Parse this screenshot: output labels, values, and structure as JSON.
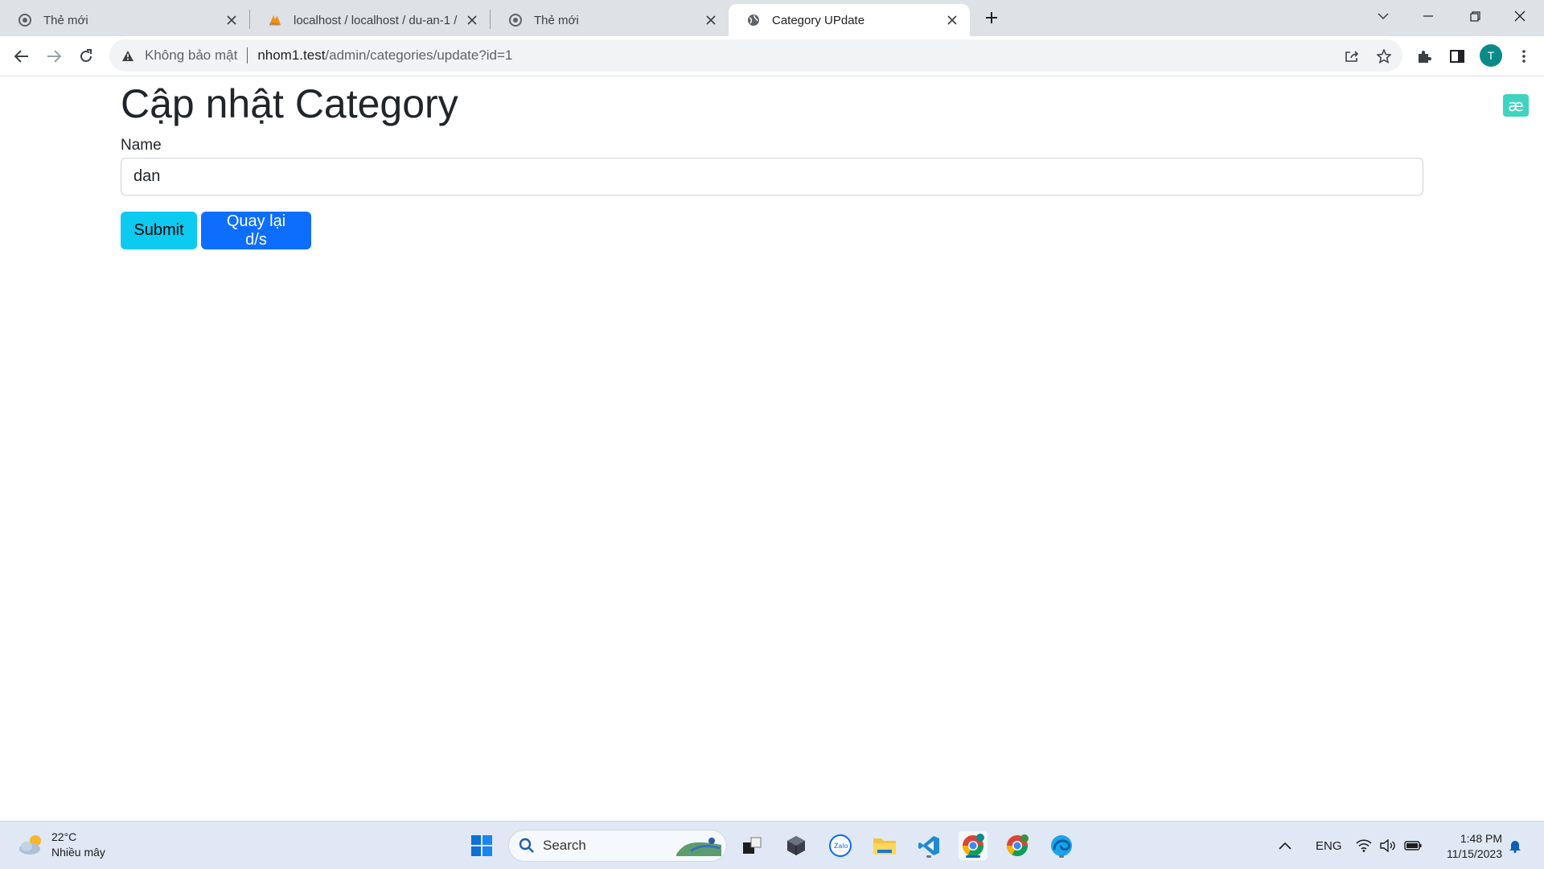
{
  "browser": {
    "tabs": [
      {
        "title": "Thẻ mới",
        "icon": "chrome-icon",
        "active": false
      },
      {
        "title": "localhost / localhost / du-an-1 / ",
        "icon": "phpmyadmin-icon",
        "active": false
      },
      {
        "title": "Thẻ mới",
        "icon": "chrome-icon",
        "active": false
      },
      {
        "title": "Category UPdate",
        "icon": "globe-icon",
        "active": true
      }
    ],
    "address": {
      "security_label": "Không bảo mật",
      "host": "nhom1.test",
      "path": "/admin/categories/update?id=1"
    },
    "profile_initial": "T"
  },
  "page": {
    "title": "Cập nhật Category",
    "name_label": "Name",
    "name_value": "dan",
    "submit_label": "Submit",
    "back_label": "Quay lại d/s",
    "extension_badge": "æ"
  },
  "taskbar": {
    "weather": {
      "temp": "22°C",
      "condition": "Nhiều mây"
    },
    "search_placeholder": "Search",
    "language": "ENG",
    "time": "1:48 PM",
    "date": "11/15/2023"
  },
  "colors": {
    "submit_button": "#0dcaf0",
    "back_button": "#0d6efd",
    "tabstrip": "#dee1e6",
    "taskbar": "#dfe8f4"
  }
}
